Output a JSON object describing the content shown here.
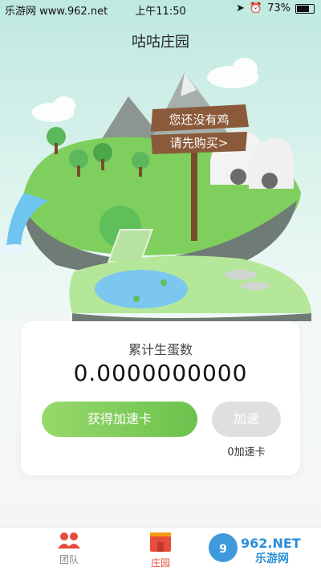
{
  "status_bar": {
    "left": "乐游网 www.962.net",
    "time": "上午11:50",
    "battery": "73%"
  },
  "page": {
    "title": "咕咕庄园"
  },
  "scene": {
    "sign_line1": "您还没有鸡",
    "sign_line2": "请先购买>"
  },
  "card": {
    "label": "累计生蛋数",
    "value": "0.0000000000",
    "get_card_button": "获得加速卡",
    "speed_button": "加速",
    "speed_card_count": "0加速卡"
  },
  "tabs": [
    {
      "label": "团队",
      "active": false
    },
    {
      "label": "庄园",
      "active": true
    }
  ],
  "watermark": {
    "brand": "962.NET",
    "sub": "乐游网"
  },
  "colors": {
    "accent_green": "#6cc14d",
    "tab_active": "#e74c3c"
  }
}
